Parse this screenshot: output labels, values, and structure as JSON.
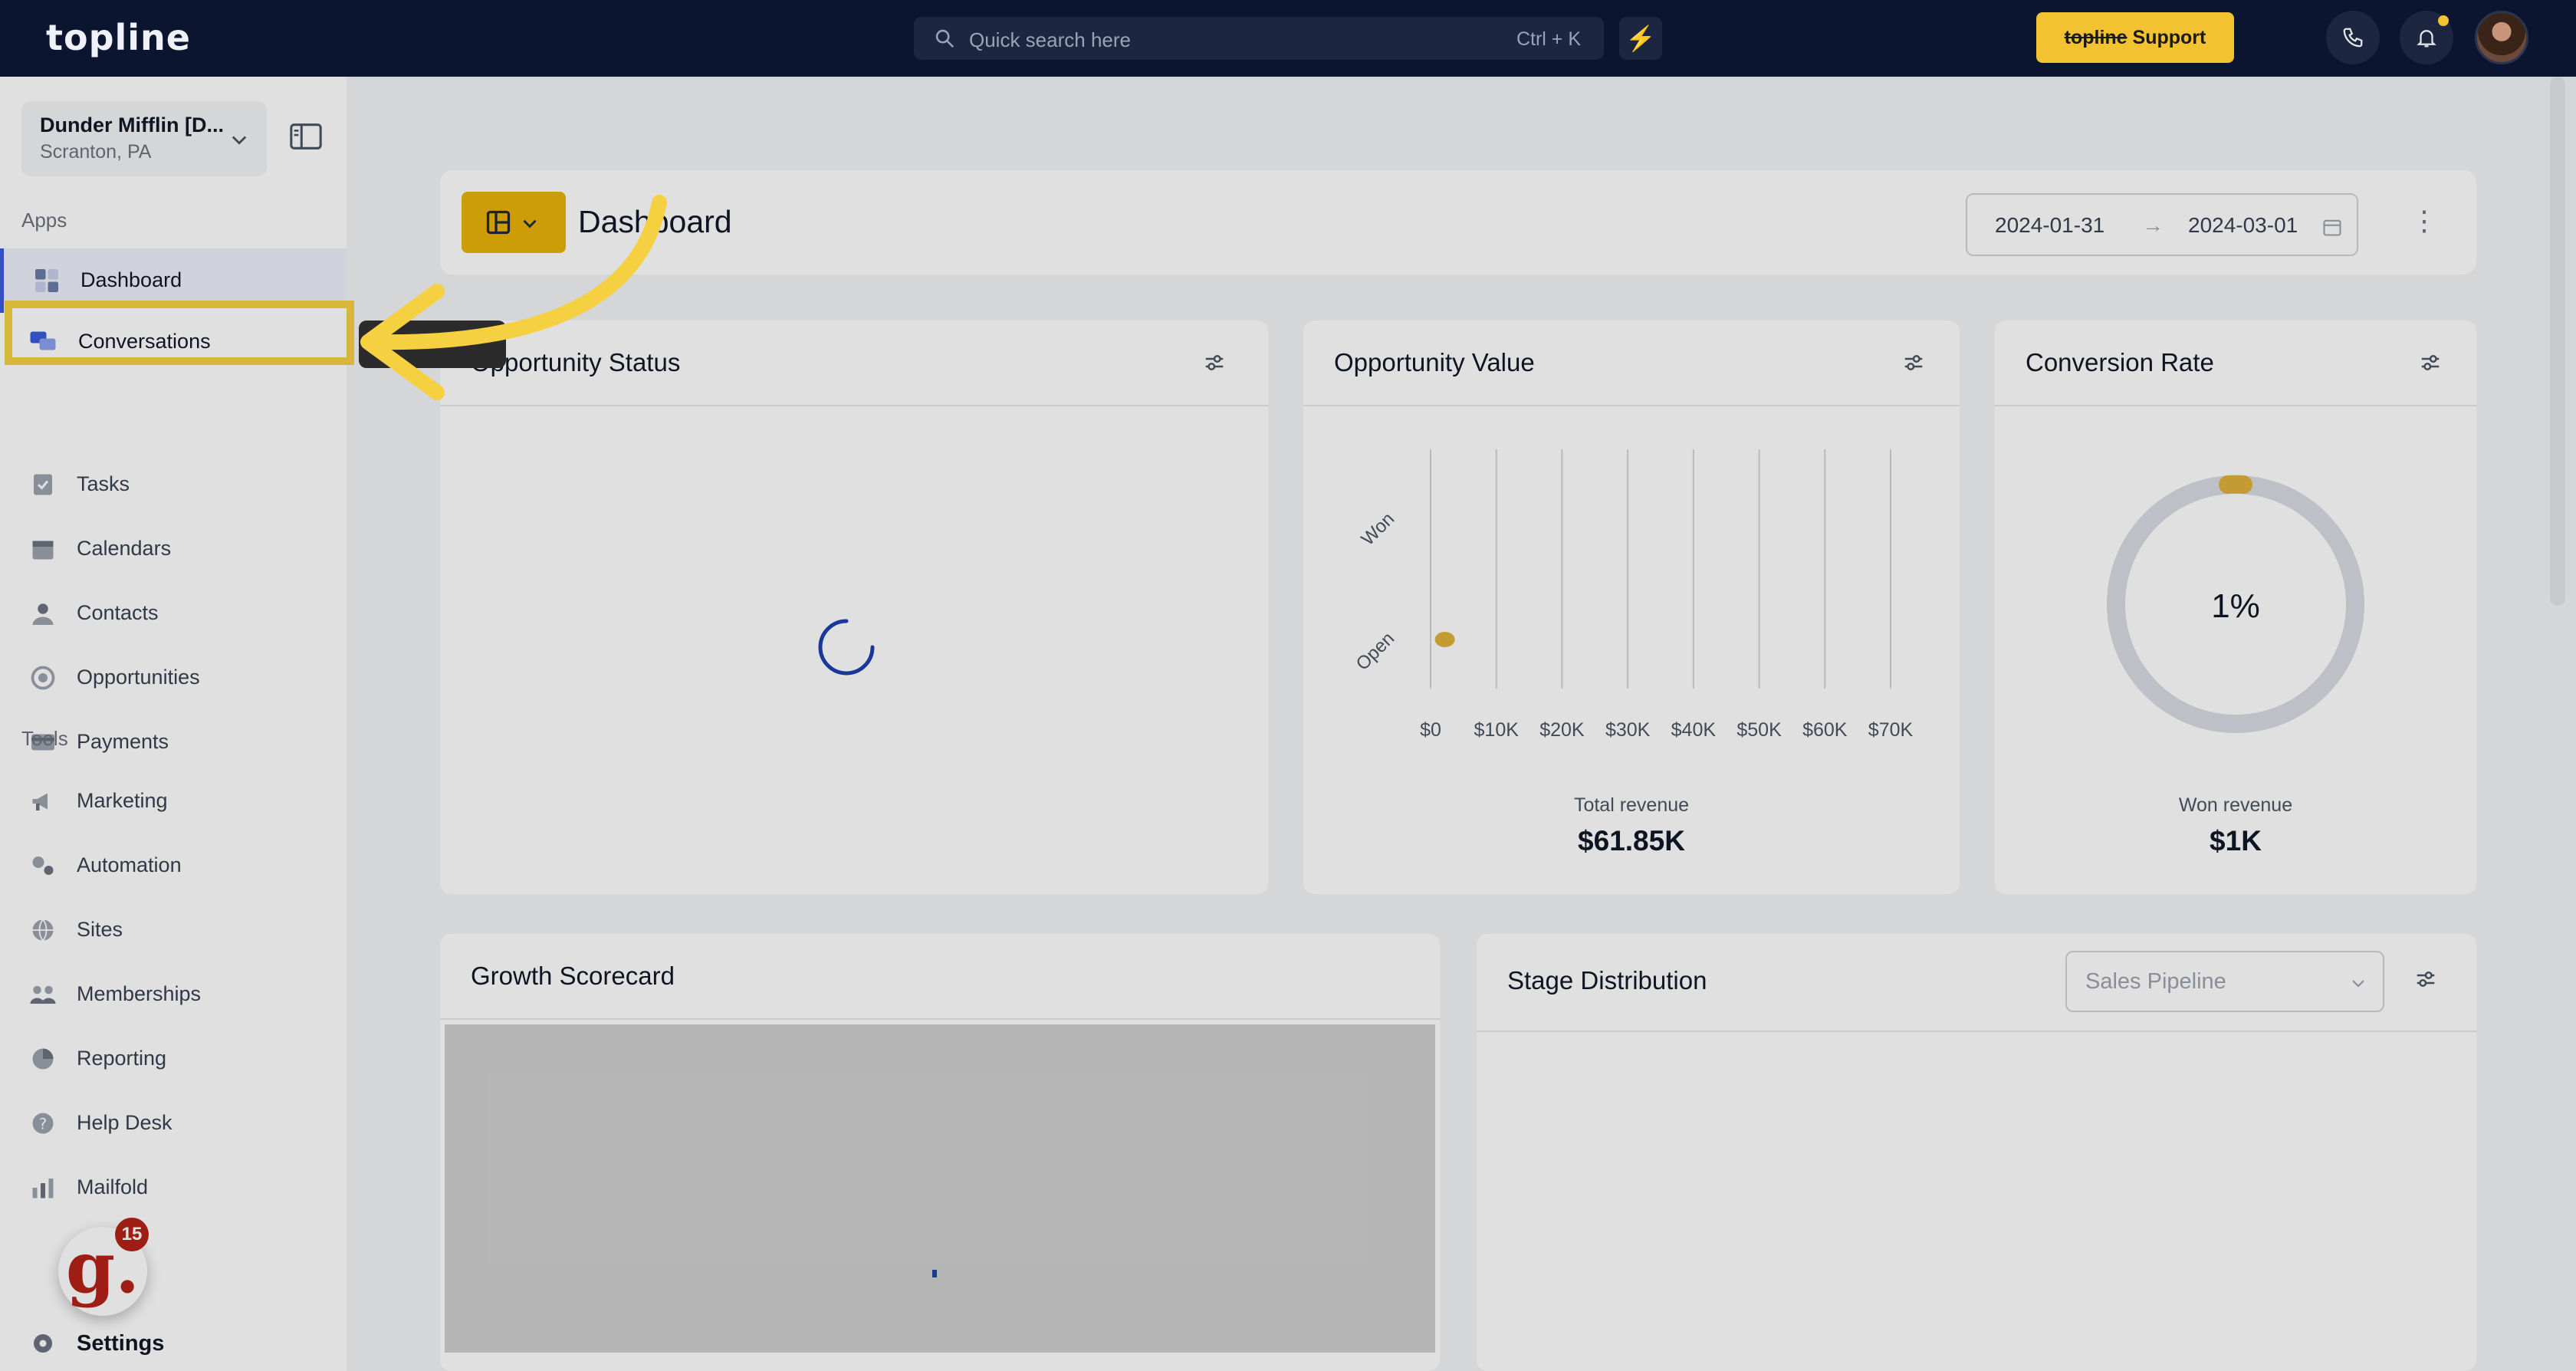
{
  "topbar": {
    "logo": "topline",
    "search_placeholder": "Quick search here",
    "search_shortcut": "Ctrl + K",
    "support_brand": "topline",
    "support_label": "Support"
  },
  "sidebar": {
    "account_name": "Dunder Mifflin [D...",
    "account_location": "Scranton, PA",
    "apps_heading": "Apps",
    "tools_heading": "Tools",
    "apps": [
      {
        "label": "Dashboard",
        "icon": "dashboard-icon"
      },
      {
        "label": "Conversations",
        "icon": "chat-bubbles-icon"
      },
      {
        "label": "Tasks",
        "icon": "task-icon"
      },
      {
        "label": "Calendars",
        "icon": "calendar-icon"
      },
      {
        "label": "Contacts",
        "icon": "person-icon"
      },
      {
        "label": "Opportunities",
        "icon": "target-icon"
      },
      {
        "label": "Payments",
        "icon": "card-icon"
      }
    ],
    "tools": [
      {
        "label": "Marketing",
        "icon": "megaphone-icon"
      },
      {
        "label": "Automation",
        "icon": "gears-icon"
      },
      {
        "label": "Sites",
        "icon": "globe-icon"
      },
      {
        "label": "Memberships",
        "icon": "people-icon"
      },
      {
        "label": "Reporting",
        "icon": "pie-icon"
      },
      {
        "label": "Help Desk",
        "icon": "help-icon"
      },
      {
        "label": "Mailfold",
        "icon": "mail-chart-icon"
      }
    ],
    "settings_label": "Settings",
    "widget_letter": "g.",
    "widget_count": "15"
  },
  "header": {
    "title": "Dashboard",
    "date_from": "2024-01-31",
    "date_to": "2024-03-01"
  },
  "cards": {
    "opportunity_status": {
      "title": "Opportunity Status"
    },
    "opportunity_value": {
      "title": "Opportunity Value",
      "kpi_label": "Total revenue",
      "kpi_value": "$61.85K"
    },
    "conversion_rate": {
      "title": "Conversion Rate",
      "center_value": "1%",
      "kpi_label": "Won revenue",
      "kpi_value": "$1K"
    },
    "growth_scorecard": {
      "title": "Growth Scorecard"
    },
    "stage_distribution": {
      "title": "Stage Distribution",
      "pipeline_select": "Sales Pipeline"
    }
  },
  "chart_data": {
    "type": "scatter",
    "title": "Opportunity Value",
    "categories": [
      "Won",
      "Open"
    ],
    "x_ticks": [
      "$0",
      "$10K",
      "$20K",
      "$30K",
      "$40K",
      "$50K",
      "$60K",
      "$70K"
    ],
    "xlim": [
      0,
      70000
    ],
    "grid": true,
    "points": [
      {
        "category": "Open",
        "value": 1000
      }
    ],
    "accent_color": "#e0b13a"
  },
  "colors": {
    "topbar": "#0b1530",
    "accent": "#f2c230",
    "highlight": "#f5d142",
    "active_nav": "#3b5bdb"
  }
}
